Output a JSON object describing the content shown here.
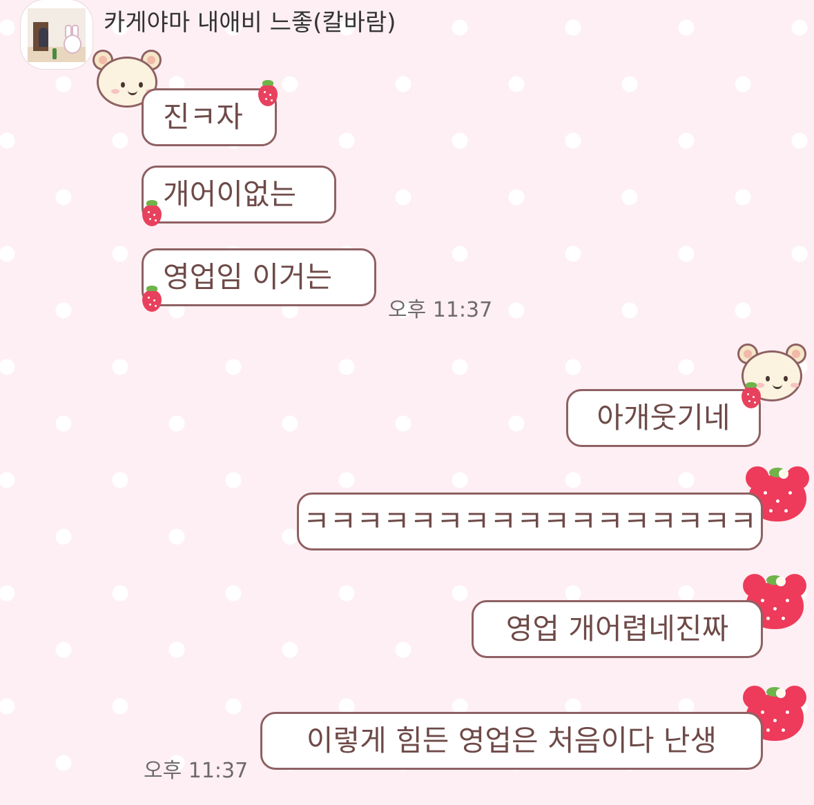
{
  "chat": {
    "sender": {
      "name": "카게야마 내애비 느좋(칼바람)",
      "avatar_icon": "profile-photo"
    },
    "messages_received": [
      {
        "text": "진ㅋ자"
      },
      {
        "text": "개어이없는"
      },
      {
        "text": "영업임 이거는"
      }
    ],
    "received_time": "오후 11:37",
    "messages_sent": [
      {
        "text": "아개웃기네"
      },
      {
        "text": "ㅋㅋㅋㅋㅋㅋㅋㅋㅋㅋㅋㅋㅋㅋㅋㅋㅋ"
      },
      {
        "text": "영업 개어렵네진짜"
      },
      {
        "text": "이렇게 힘든 영업은 처음이다 난생"
      }
    ],
    "sent_time": "오후 11:37"
  },
  "theme": {
    "background": "#fdeff3",
    "polka_dot": "#ffffff",
    "bubble_fill": "#ffffff",
    "bubble_border": "#8e6062",
    "text_color": "#6e4a48",
    "strawberry": "#e8415d"
  },
  "decorations": {
    "bear_icon": "rilakkuma-bear-icon",
    "strawberry_icon": "strawberry-icon",
    "strawberry_bear_icon": "strawberry-bear-icon"
  }
}
